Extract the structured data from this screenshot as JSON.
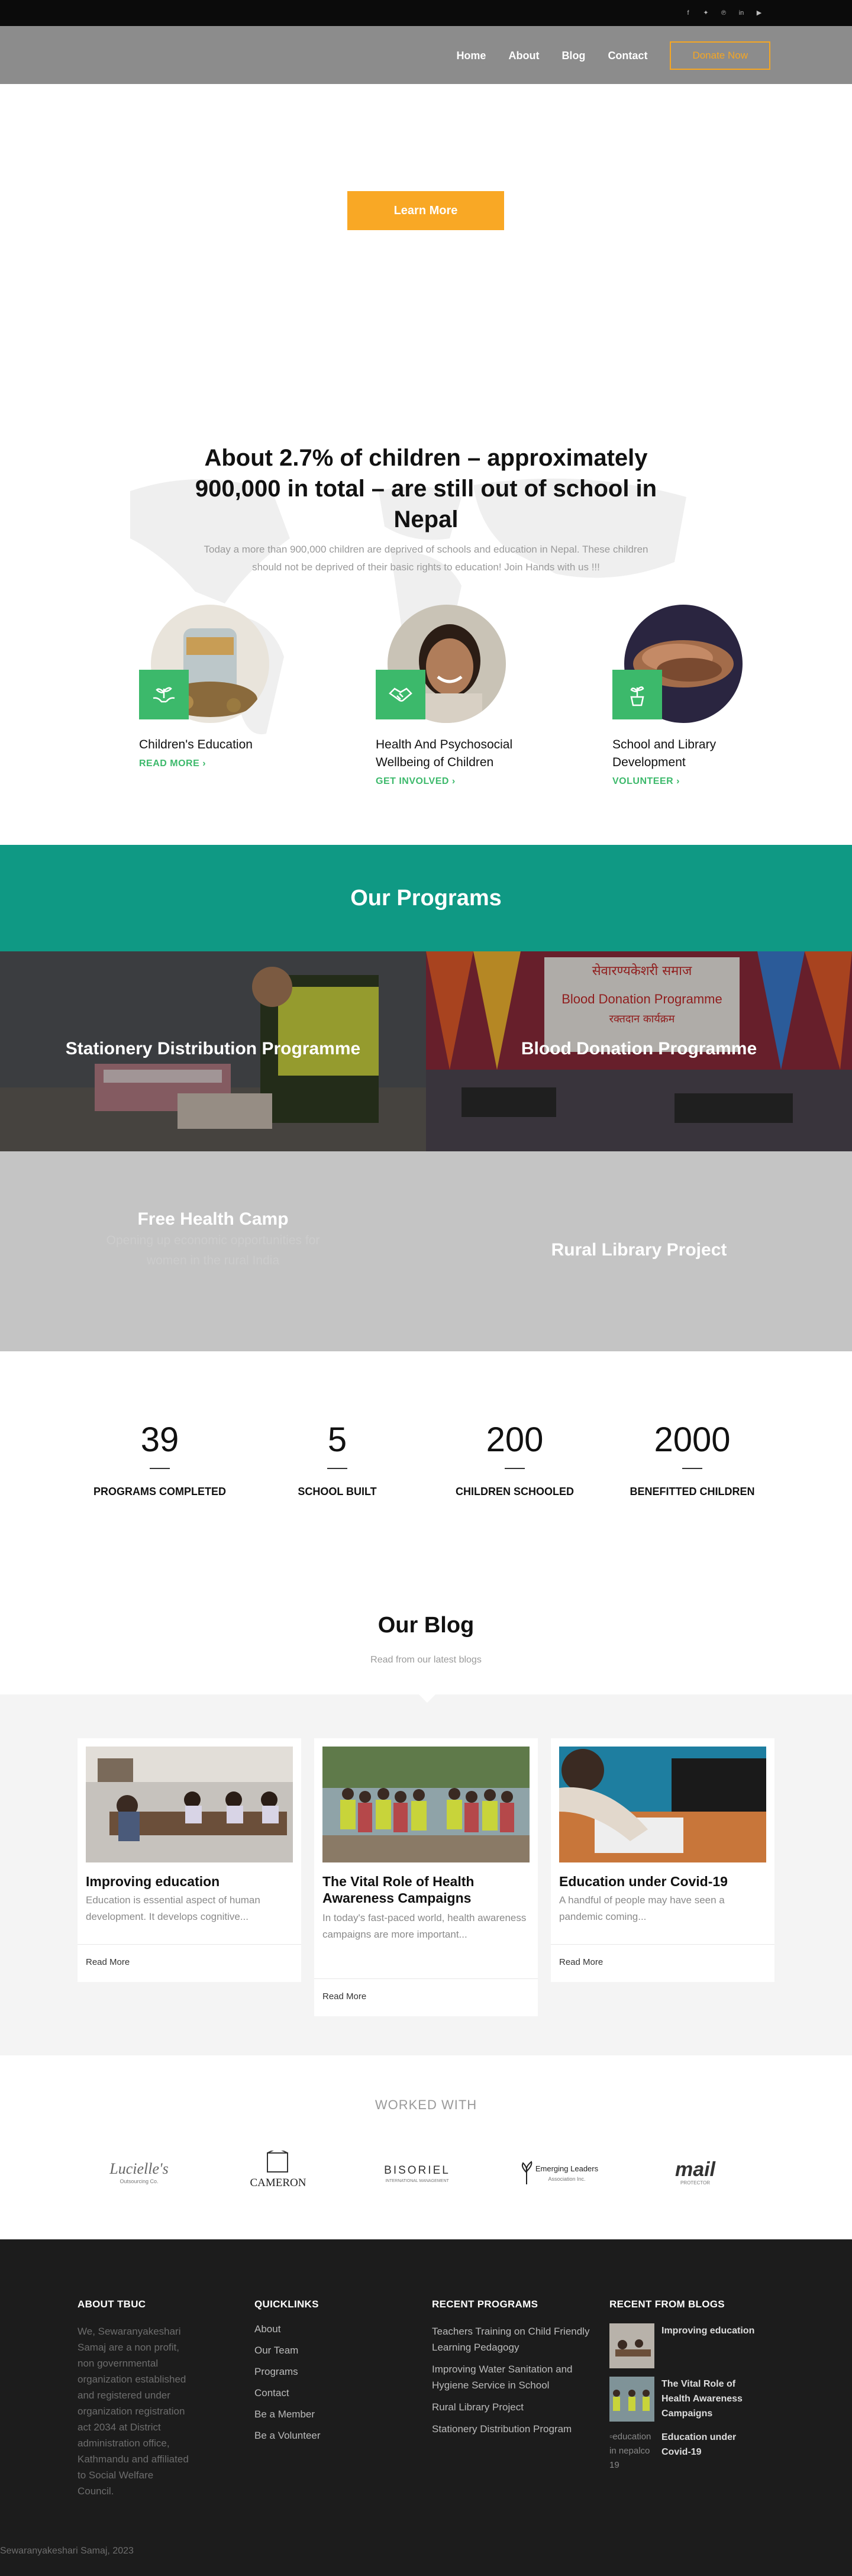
{
  "social": {
    "icons": [
      "facebook-icon",
      "twitter-icon",
      "pinterest-icon",
      "linkedin-icon",
      "youtube-icon"
    ]
  },
  "nav": {
    "home": "Home",
    "about": "About",
    "blog": "Blog",
    "contact": "Contact",
    "donate": "Donate Now"
  },
  "hero": {
    "button": "Learn More"
  },
  "about": {
    "title": "About 2.7% of children – approximately 900,000 in total – are still out of school in Nepal",
    "subtitle": "Today a more than 900,000 children are deprived of schools and education in Nepal. These children should not be deprived of their basic rights to education! Join Hands with us !!!",
    "features": [
      {
        "title": "Children's Education",
        "link": "READ MORE ›",
        "icon": "hands-plant-icon"
      },
      {
        "title": "Health And Psychosocial Wellbeing of Children",
        "link": "GET INVOLVED ›",
        "icon": "handshake-icon"
      },
      {
        "title": "School and Library Development",
        "link": "VOLUNTEER ›",
        "icon": "potted-plant-icon"
      }
    ]
  },
  "programs": {
    "heading": "Our Programs",
    "items": [
      {
        "title": "Stationery Distribution Programme"
      },
      {
        "title": "Blood Donation Programme",
        "banner_line1": "सेवारण्यकेशरी समाज",
        "banner_line2": "Blood Donation Programme",
        "banner_line3": "रक्तदान कार्यक्रम"
      },
      {
        "title": "Free Health Camp",
        "desc": "Opening up economic opportunities for women in the rural India"
      },
      {
        "title": "Rural Library Project"
      }
    ]
  },
  "stats": [
    {
      "value": "39",
      "label": "PROGRAMS COMPLETED"
    },
    {
      "value": "5",
      "label": "SCHOOL BUILT"
    },
    {
      "value": "200",
      "label": "CHILDREN SCHOOLED"
    },
    {
      "value": "2000",
      "label": "BENEFITTED CHILDREN"
    }
  ],
  "blog": {
    "title": "Our Blog",
    "subtitle": "Read from our latest blogs",
    "posts": [
      {
        "title": "Improving education",
        "desc": "Education is essential aspect of human development. It develops cognitive...",
        "more": "Read More"
      },
      {
        "title": "The Vital Role of Health Awareness Campaigns",
        "desc": "In today's fast-paced world, health awareness campaigns are more important...",
        "more": "Read More"
      },
      {
        "title": "Education under Covid-19",
        "desc": "A handful of people may have seen a pandemic coming...",
        "more": "Read More"
      }
    ]
  },
  "partners": {
    "heading": "WORKED WITH",
    "logos": [
      {
        "name": "Lucielle's",
        "sub": "Outsourcing Co."
      },
      {
        "name": "CAMERON",
        "sub": ""
      },
      {
        "name": "BISORIEL",
        "sub": "INTERNATIONAL MANAGEMENT"
      },
      {
        "name": "Emerging Leaders",
        "sub": "Association Inc."
      },
      {
        "name": "mail",
        "sub": "PROTECTOR"
      }
    ]
  },
  "footer": {
    "about_heading": "ABOUT TBUC",
    "about_text": "We, Sewaranyakeshari Samaj are a non profit, non governmental organization established and registered under organization registration act 2034 at District administration office, Kathmandu and affiliated to Social Welfare Council.",
    "quick_heading": "QUICKLINKS",
    "quick_links": [
      "About",
      "Our Team",
      "Programs",
      "Contact",
      "Be a Member",
      "Be a Volunteer"
    ],
    "programs_heading": "RECENT PROGRAMS",
    "programs": [
      "Teachers Training on Child Friendly Learning Pedagogy",
      "Improving Water Sanitation and Hygiene Service in School",
      "Rural Library Project",
      "Stationery Distribution Program"
    ],
    "blogs_heading": "RECENT FROM BLOGS",
    "blogs": [
      "Improving education",
      "The Vital Role of Health Awareness Campaigns",
      "Education under Covid-19"
    ],
    "broken_alt": "education in nepalco 19",
    "copyright": "Sewaranyakeshari Samaj, 2023"
  },
  "colors": {
    "accent_green": "#3cb96b",
    "teal": "#0f9984",
    "orange": "#f9a825",
    "footer_bg": "#1c1c1c"
  }
}
